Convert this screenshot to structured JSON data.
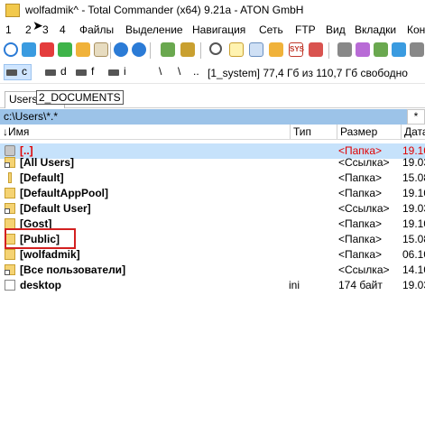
{
  "window": {
    "title": "wolfadmik^ - Total Commander (x64) 9.21a - ATON GmbH"
  },
  "menu": {
    "items": [
      "1",
      "2",
      "3",
      "4",
      "Файлы",
      "Выделение",
      "Навигация",
      "Сеть",
      "FTP",
      "Вид",
      "Вкладки",
      "Кон"
    ]
  },
  "toolbar": {
    "icons": [
      "refresh-icon",
      "brief-view-icon",
      "full-view-icon",
      "tree-icon",
      "thumbnails-icon",
      "sort-icon",
      "back-icon",
      "forward-icon",
      "pack-icon",
      "unpack-icon",
      "search-icon",
      "new-file-icon",
      "multi-rename-icon",
      "sync-dirs-icon",
      "ftp-icon",
      "notepad-icon",
      "printer-icon",
      "settings-icon",
      "archive-icon",
      "quick-view-icon",
      "copy-names-icon",
      "compare-icon"
    ]
  },
  "drives": {
    "items": [
      {
        "letter": "c",
        "active": true
      },
      {
        "letter": "d",
        "active": false
      },
      {
        "letter": "f",
        "active": false
      },
      {
        "letter": "i",
        "active": false
      }
    ],
    "root_label": "\\",
    "up_label": "..",
    "info": "[1_system]  77,4 Гб из 110,7 Гб свободно"
  },
  "tabs": {
    "active_label": "Users",
    "tooltip": "2_DOCUMENTS"
  },
  "path": {
    "current": "c:\\Users\\*.*",
    "filter_label": "*"
  },
  "columns": {
    "name": "↓Имя",
    "type": "Тип",
    "size": "Размер",
    "date": "Дата"
  },
  "files": [
    {
      "name": "[..]",
      "type": "",
      "size": "<Папка>",
      "date": "19.10",
      "kind": "up"
    },
    {
      "name": "[All Users]",
      "type": "",
      "size": "<Ссылка>",
      "date": "19.03",
      "kind": "link"
    },
    {
      "name": "[Default]",
      "type": "",
      "size": "<Папка>",
      "date": "15.08",
      "kind": "hidden"
    },
    {
      "name": "[DefaultAppPool]",
      "type": "",
      "size": "<Папка>",
      "date": "19.10",
      "kind": "folder"
    },
    {
      "name": "[Default User]",
      "type": "",
      "size": "<Ссылка>",
      "date": "19.03",
      "kind": "link"
    },
    {
      "name": "[Gost]",
      "type": "",
      "size": "<Папка>",
      "date": "19.10",
      "kind": "folder"
    },
    {
      "name": "[Public]",
      "type": "",
      "size": "<Папка>",
      "date": "15.08",
      "kind": "folder"
    },
    {
      "name": "[wolfadmik]",
      "type": "",
      "size": "<Папка>",
      "date": "06.10",
      "kind": "folder"
    },
    {
      "name": "[Все пользователи]",
      "type": "",
      "size": "<Ссылка>",
      "date": "14.10",
      "kind": "link"
    },
    {
      "name": "desktop",
      "type": "ini",
      "size": "174 байт",
      "date": "19.03",
      "kind": "file"
    }
  ],
  "colors": {
    "path_bar": "#9cc3e8",
    "cursor_row": "#c6e2fb",
    "updir_text": "#e00000",
    "annotation_box": "#d32020"
  }
}
